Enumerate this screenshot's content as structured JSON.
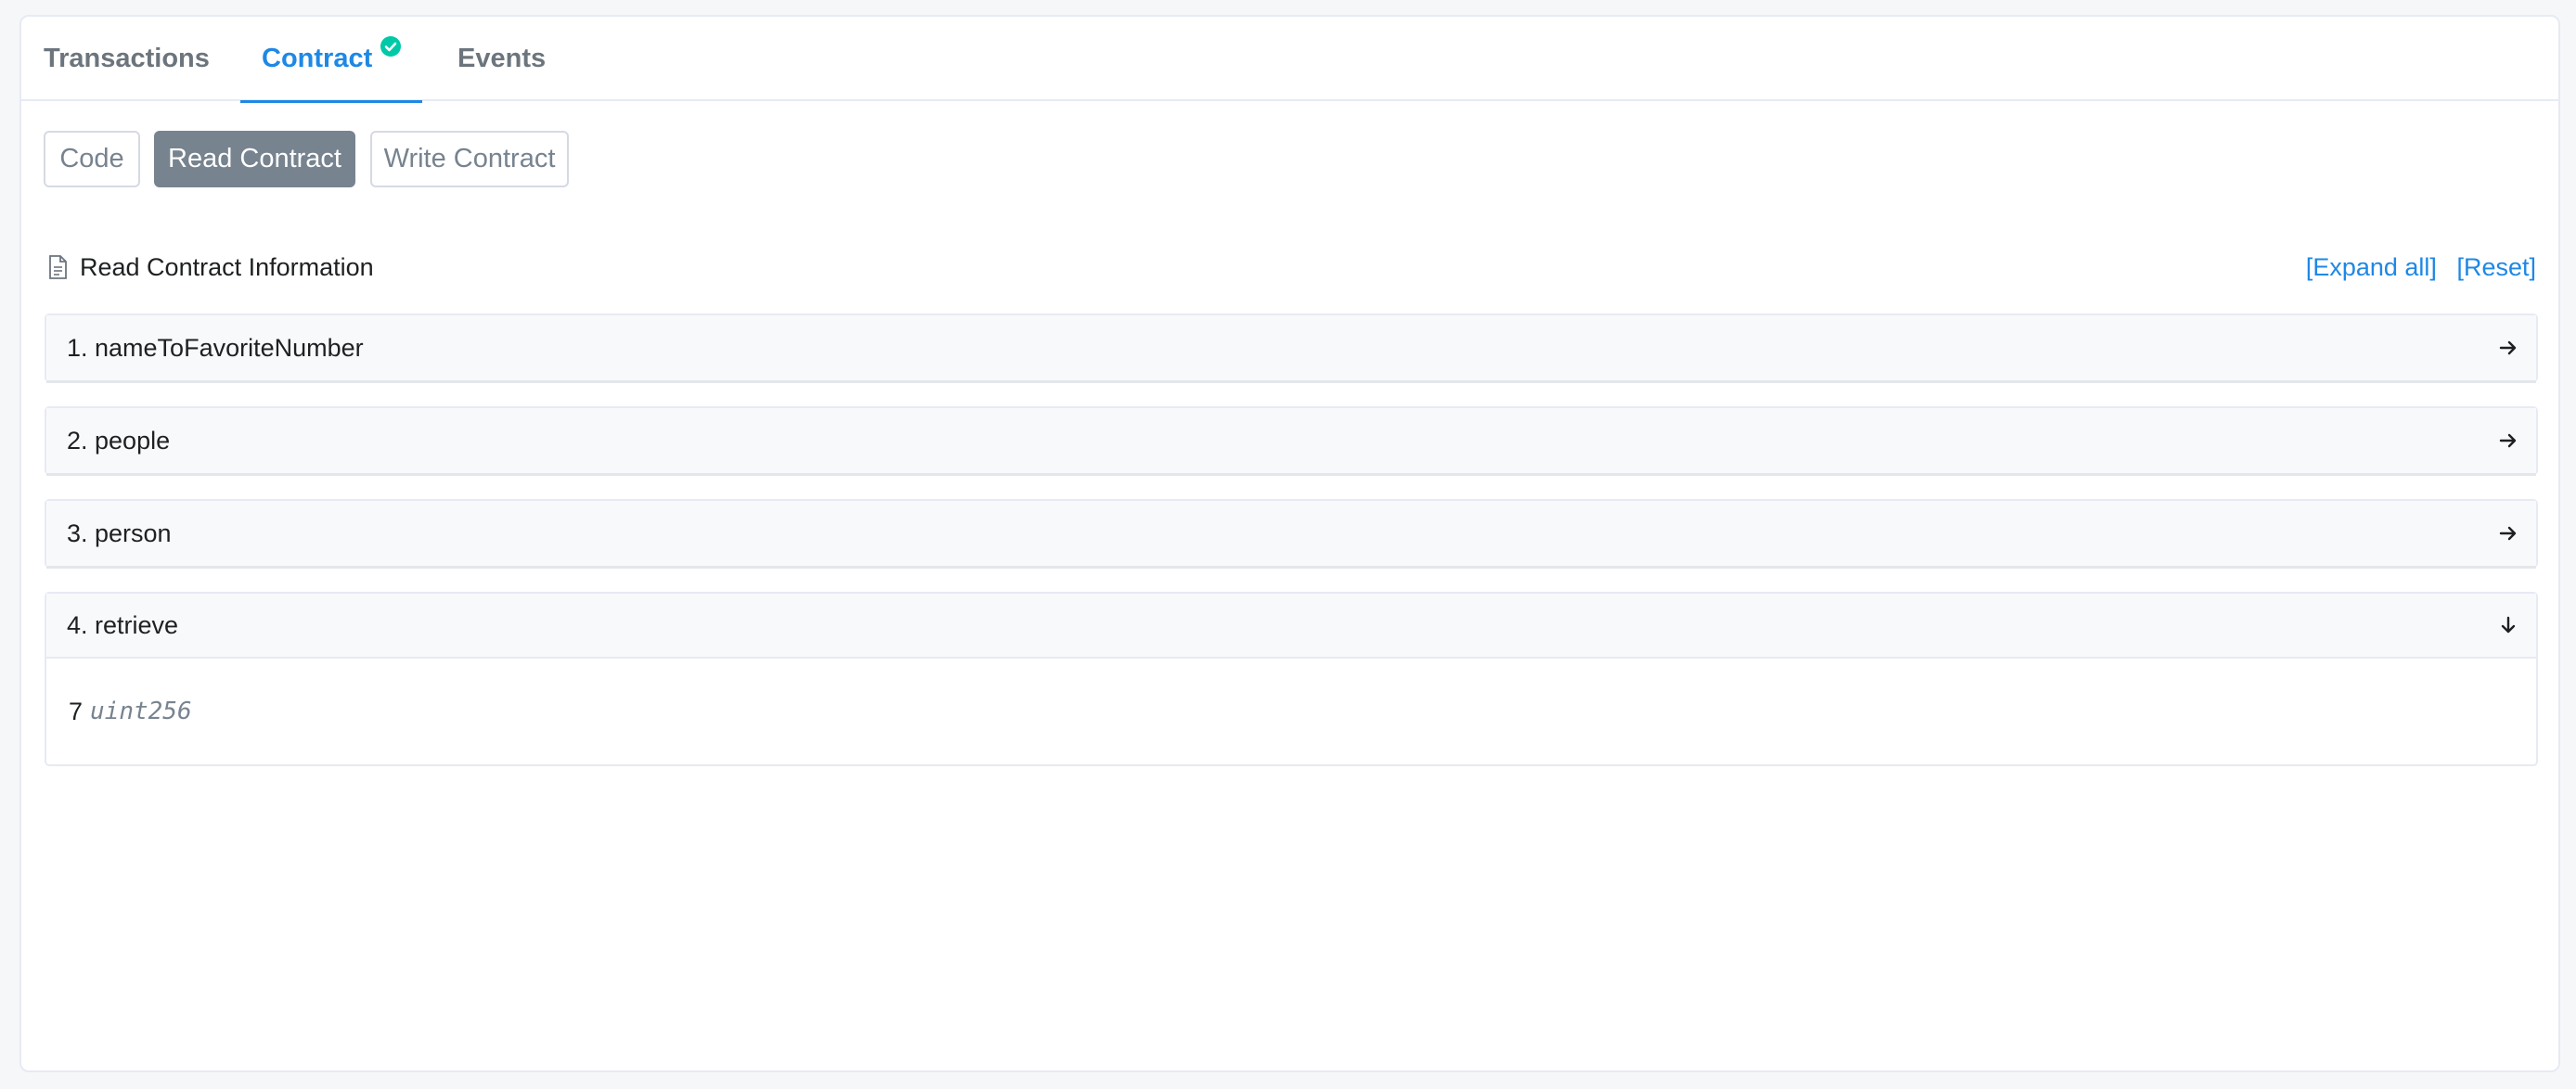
{
  "tabs": [
    {
      "label": "Transactions"
    },
    {
      "label": "Contract"
    },
    {
      "label": "Events"
    }
  ],
  "sub_tabs": {
    "code": "Code",
    "read": "Read Contract",
    "write": "Write Contract"
  },
  "info": {
    "title": "Read Contract Information",
    "expand_all": "[Expand all]",
    "reset": "[Reset]"
  },
  "functions": [
    {
      "label": "1. nameToFavoriteNumber",
      "state": "collapsed",
      "icon": "arrow-right-icon"
    },
    {
      "label": "2. people",
      "state": "collapsed",
      "icon": "arrow-right-icon"
    },
    {
      "label": "3. person",
      "state": "collapsed",
      "icon": "arrow-right-icon"
    },
    {
      "label": "4. retrieve",
      "state": "expanded",
      "icon": "arrow-down-icon",
      "result_value": "7",
      "result_type": "uint256"
    }
  ],
  "colors": {
    "accent": "#1e88e5",
    "verified": "#00c9a7",
    "active_button": "#77838f"
  }
}
